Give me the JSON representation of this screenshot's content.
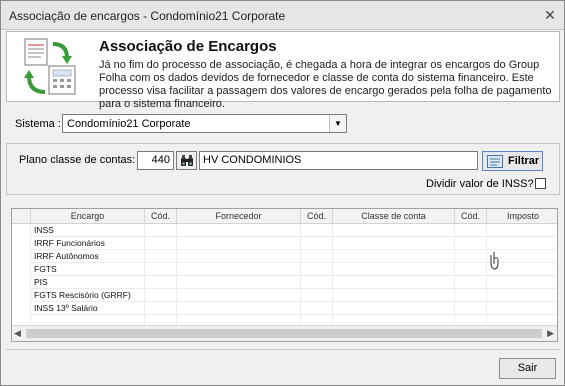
{
  "window": {
    "title": "Associação de encargos - Condomínio21 Corporate"
  },
  "header": {
    "title": "Associação de Encargos",
    "description": "Já no fim do processo de associação, é chegada a hora de integrar os encargos do Group Folha com os dados devidos de fornecedor e classe de conta do sistema financeiro. Este processo visa facilitar a passagem dos valores de encargo gerados pela folha de pagamento para o sistema financeiro."
  },
  "sistema": {
    "label": "Sistema :",
    "value": "Condomínio21 Corporate"
  },
  "plano": {
    "label": "Plano classe de contas:",
    "code": "440",
    "name": "HV CONDOMINIOS"
  },
  "filtrar": {
    "label": "Filtrar"
  },
  "dividir": {
    "label": "Dividir valor de INSS?",
    "checked": false
  },
  "grid": {
    "columns": [
      "Encargo",
      "Cód.",
      "Fornecedor",
      "Cód.",
      "Classe de conta",
      "Cód.",
      "Imposto"
    ],
    "rows": [
      "INSS",
      "IRRF Funcionários",
      "IRRF Autônomos",
      "FGTS",
      "PIS",
      "FGTS Rescisório (GRRF)",
      "INSS 13º Salário"
    ]
  },
  "footer": {
    "sair_label": "Sair"
  },
  "icons": {
    "header": "documents-recycle-icon",
    "search": "binoculars-icon",
    "filter": "filter-icon",
    "close": "close-icon"
  }
}
